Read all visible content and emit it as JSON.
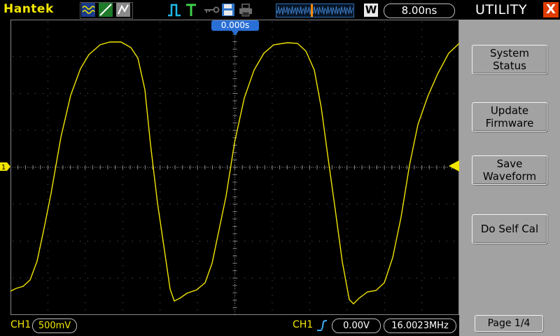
{
  "header": {
    "brand": "Hantek",
    "timebase": "8.00ns",
    "w_label": "W",
    "trigger_position": "0.000s"
  },
  "icons": {
    "acquire_mode": "waveform-mode-icon",
    "trigger_type": "edge-trigger-icon",
    "save": "floppy-disk-icon",
    "print": "printer-icon",
    "key": "key-icon",
    "run_state": "trigger-T-icon"
  },
  "colors": {
    "channel1": "#f2e600",
    "trigger_badge": "#2a6fd6",
    "close": "#e03c00",
    "menu_bg": "#a2a2a2",
    "grid": "#6a6a6a"
  },
  "bottom": {
    "ch1_label": "CH1",
    "ch1_scale": "500mV",
    "trigger_source": "CH1",
    "trigger_level": "0.00V",
    "frequency": "16.0023MHz"
  },
  "menu": {
    "title": "UTILITY",
    "close": "X",
    "buttons": [
      {
        "line1": "System",
        "line2": "Status"
      },
      {
        "line1": "Update",
        "line2": "Firmware"
      },
      {
        "line1": "Save",
        "line2": "Waveform"
      },
      {
        "line1": "Do Self Cal",
        "line2": ""
      }
    ],
    "page": "Page 1/4"
  },
  "markers": {
    "channel": "1"
  }
}
